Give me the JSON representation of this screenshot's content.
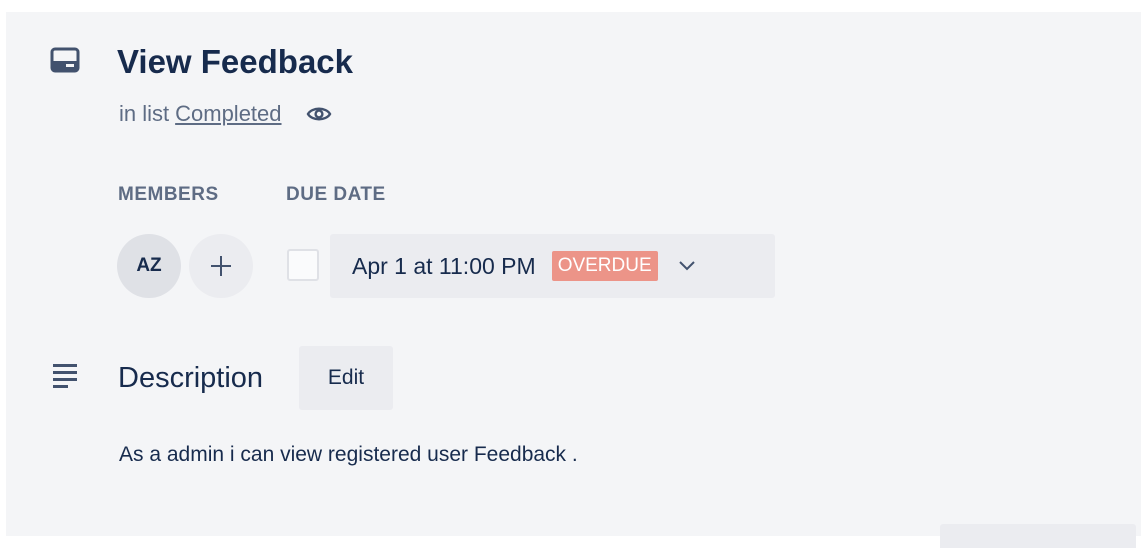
{
  "card": {
    "title": "View Feedback",
    "list_prefix": "in list",
    "list_name": "Completed"
  },
  "members": {
    "label": "MEMBERS",
    "avatar_initials": "AZ"
  },
  "due_date": {
    "label": "DUE DATE",
    "value": "Apr 1 at 11:00 PM",
    "badge": "OVERDUE",
    "checked": false
  },
  "description": {
    "title": "Description",
    "edit_label": "Edit",
    "text": "As a admin i can view registered user Feedback ."
  },
  "colors": {
    "card_bg": "#f4f5f7",
    "text_primary": "#172b4d",
    "text_secondary": "#5e6c84",
    "button_bg": "#ebecf0",
    "overdue_bg": "#ec9488"
  },
  "icons": {
    "header": "card-icon",
    "watch": "eye-icon",
    "add_member": "plus-icon",
    "due_menu": "chevron-down-icon",
    "description": "description-icon"
  }
}
